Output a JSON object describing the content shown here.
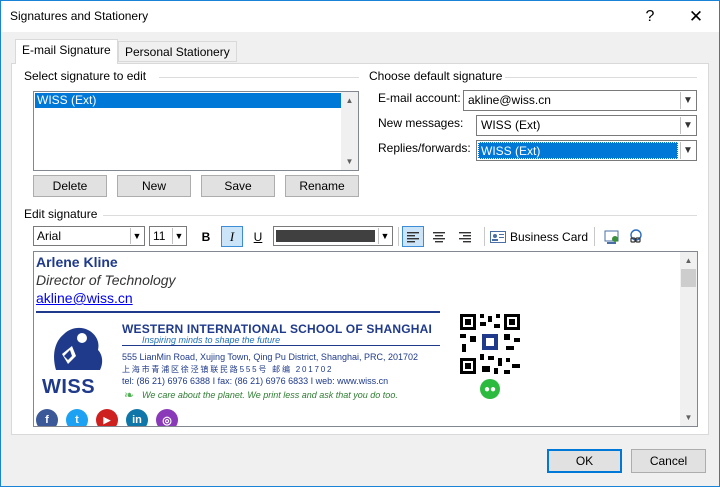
{
  "window": {
    "title": "Signatures and Stationery",
    "help_glyph": "?",
    "close_glyph": "✕"
  },
  "tabs": [
    {
      "label": "E-mail Signature",
      "active": true
    },
    {
      "label": "Personal Stationery",
      "active": false
    }
  ],
  "select_signature": {
    "heading": "Select signature to edit",
    "items": [
      "WISS (Ext)"
    ],
    "selected": "WISS (Ext)",
    "buttons": {
      "delete": "Delete",
      "new": "New",
      "save": "Save",
      "rename": "Rename"
    }
  },
  "default_signature": {
    "heading": "Choose default signature",
    "email_account_label": "E-mail account:",
    "email_account_value": "akline@wiss.cn",
    "new_messages_label": "New messages:",
    "new_messages_value": "WISS (Ext)",
    "replies_label": "Replies/forwards:",
    "replies_value": "WISS (Ext)"
  },
  "edit_signature": {
    "heading": "Edit signature",
    "toolbar": {
      "font": "Arial",
      "size": "11",
      "bold": "B",
      "italic": "I",
      "underline": "U",
      "font_color": "#404040",
      "business_card": "Business Card",
      "italic_active": true
    },
    "signature": {
      "name": "Arlene Kline",
      "role": "Director of Technology",
      "email": "akline@wiss.cn",
      "logo_text": "WISS",
      "school": "WESTERN INTERNATIONAL SCHOOL OF SHANGHAI",
      "tagline": "Inspiring minds to shape the future",
      "address_en": "555 LianMin Road, Xujing Town, Qing Pu District, Shanghai, PRC, 201702",
      "address_cn": "上海市青浦区徐泾镇联民路555号    邮编 201702",
      "contact": "tel: (86 21) 6976 6388  I  fax: (86 21) 6976 6833  I  web: www.wiss.cn",
      "eco_note": "We care about the planet. We print less and ask that you do too.",
      "social": [
        {
          "icon": "facebook-icon",
          "glyph": "f",
          "color": "#3b5998"
        },
        {
          "icon": "twitter-icon",
          "glyph": "t",
          "color": "#1da1f2"
        },
        {
          "icon": "youtube-icon",
          "glyph": "▶",
          "color": "#cd201f"
        },
        {
          "icon": "linkedin-icon",
          "glyph": "in",
          "color": "#0e76a8"
        },
        {
          "icon": "instagram-icon",
          "glyph": "◎",
          "color": "#8a3ab9"
        }
      ]
    }
  },
  "footer": {
    "ok": "OK",
    "cancel": "Cancel"
  },
  "colors": {
    "accent": "#0078d7",
    "brand_navy": "#1f3a8a"
  }
}
